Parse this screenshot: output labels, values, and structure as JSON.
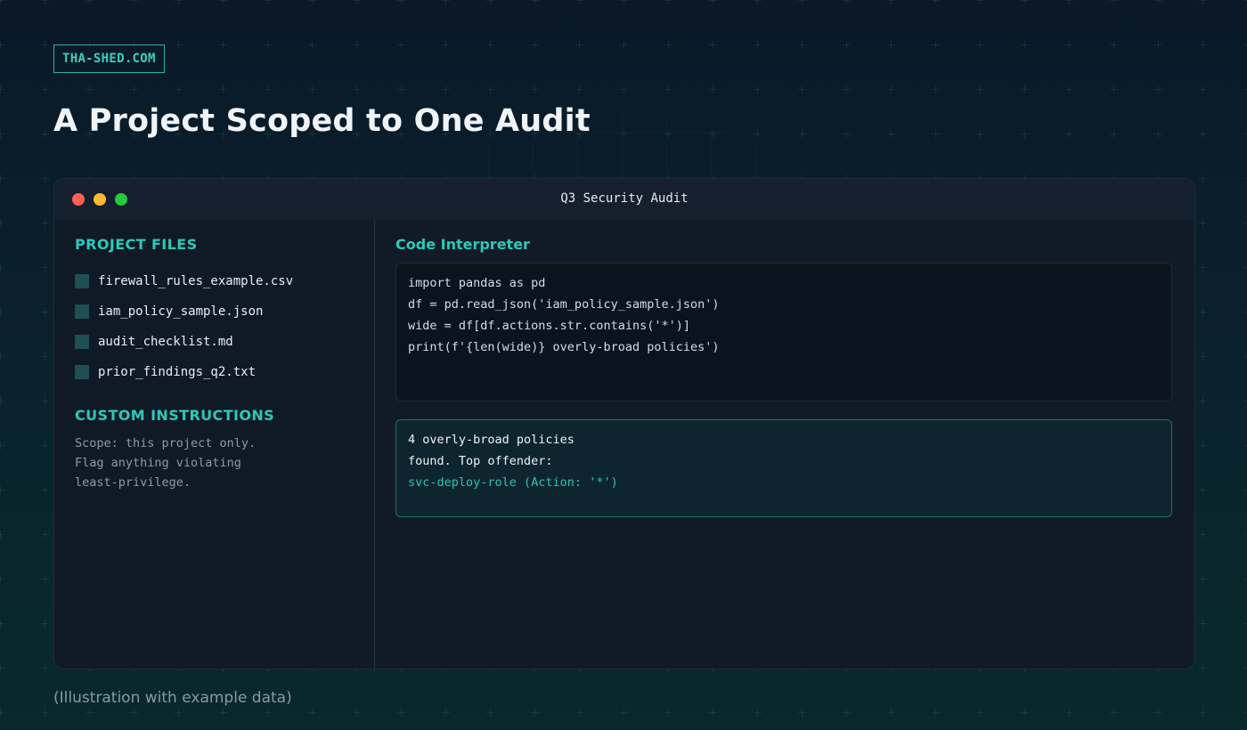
{
  "brand": "THA-SHED.COM",
  "headline": "A Project Scoped to One Audit",
  "window": {
    "title": "Q3 Security Audit"
  },
  "sidebar": {
    "files_title": "PROJECT FILES",
    "files": [
      {
        "name": "firewall_rules_example.csv"
      },
      {
        "name": "iam_policy_sample.json"
      },
      {
        "name": "audit_checklist.md"
      },
      {
        "name": "prior_findings_q2.txt"
      }
    ],
    "instructions_title": "CUSTOM INSTRUCTIONS",
    "instructions_text": "Scope: this project only.\nFlag anything violating\nleast-privilege."
  },
  "main": {
    "title": "Code Interpreter",
    "code_lines": [
      "import pandas as pd",
      "df = pd.read_json('iam_policy_sample.json')",
      "wide = df[df.actions.str.contains('*')]",
      "print(f'{len(wide)} overly-broad policies')"
    ],
    "output_lines": [
      "4 overly-broad policies",
      "found. Top offender:",
      "svc-deploy-role (Action: '*')"
    ]
  },
  "caption": "(Illustration with example data)",
  "colors": {
    "accent": "#2cc9b8",
    "background": "#0a1828",
    "window": "#111b27",
    "dot_red": "#ff5f57",
    "dot_yellow": "#febc2e",
    "dot_green": "#28c840"
  }
}
